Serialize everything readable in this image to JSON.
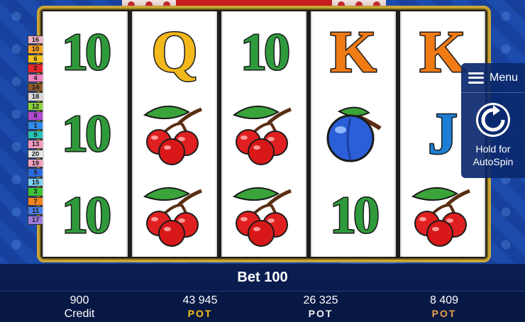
{
  "paylines": [
    {
      "num": "16",
      "color": "#f1b4c8"
    },
    {
      "num": "10",
      "color": "#f6a020"
    },
    {
      "num": "6",
      "color": "#f6c21a"
    },
    {
      "num": "2",
      "color": "#e8262e"
    },
    {
      "num": "4",
      "color": "#f081c0"
    },
    {
      "num": "14",
      "color": "#8b5a2b"
    },
    {
      "num": "18",
      "color": "#d8d8d8"
    },
    {
      "num": "12",
      "color": "#8cd43c"
    },
    {
      "num": "8",
      "color": "#b04ad4"
    },
    {
      "num": "1",
      "color": "#2e8bf0"
    },
    {
      "num": "9",
      "color": "#27c3b3"
    },
    {
      "num": "13",
      "color": "#f59bc3"
    },
    {
      "num": "20",
      "color": "#e6e6e6"
    },
    {
      "num": "19",
      "color": "#f4a2c2"
    },
    {
      "num": "5",
      "color": "#2a6ae0"
    },
    {
      "num": "15",
      "color": "#7dd0f3"
    },
    {
      "num": "3",
      "color": "#3fc23b"
    },
    {
      "num": "7",
      "color": "#f3831f"
    },
    {
      "num": "11",
      "color": "#4a7ee8"
    },
    {
      "num": "17",
      "color": "#9e7be0"
    }
  ],
  "reels": [
    [
      "10",
      "10",
      "10"
    ],
    [
      "Q",
      "cherry",
      "cherry"
    ],
    [
      "10",
      "cherry",
      "cherry"
    ],
    [
      "K",
      "plum",
      "10"
    ],
    [
      "K",
      "J",
      "cherry"
    ]
  ],
  "menu": {
    "label": "Menu",
    "icon": "hamburger-icon"
  },
  "autospin": {
    "line1": "Hold for",
    "line2": "AutoSpin",
    "icon": "refresh-icon"
  },
  "bet": {
    "text": "Bet 100"
  },
  "credit": {
    "value": "900",
    "label": "Credit"
  },
  "pots": [
    {
      "value": "43 945",
      "label": "POT",
      "color": "#f3c21a"
    },
    {
      "value": "26 325",
      "label": "POT",
      "color": "#f2f2f2"
    },
    {
      "value": "8 409",
      "label": "POT",
      "color": "#e8a24a"
    }
  ]
}
